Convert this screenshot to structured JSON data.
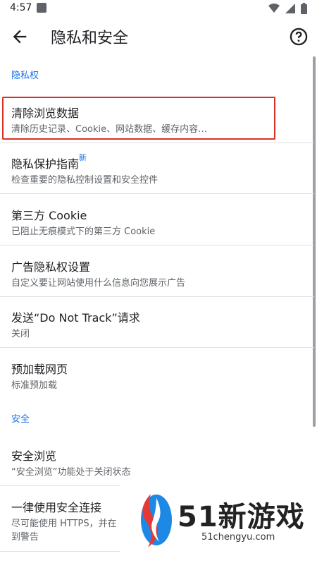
{
  "status_bar": {
    "time": "4:57"
  },
  "app_bar": {
    "title": "隐私和安全"
  },
  "sections": {
    "privacy_header": "隐私权",
    "security_header": "安全"
  },
  "rows": [
    {
      "title": "清除浏览数据",
      "subtitle": "清除历史记录、Cookie、网站数据、缓存内容…"
    },
    {
      "title": "隐私保护指南",
      "badge": "新",
      "subtitle": "检查重要的隐私控制设置和安全控件"
    },
    {
      "title": "第三方 Cookie",
      "subtitle": "已阻止无痕模式下的第三方 Cookie"
    },
    {
      "title": "广告隐私权设置",
      "subtitle": "自定义要让网站使用什么信息向您展示广告"
    },
    {
      "title": "发送“Do Not Track”请求",
      "subtitle": "关闭"
    },
    {
      "title": "预加载网页",
      "subtitle": "标准预加载"
    },
    {
      "title": "安全浏览",
      "subtitle": "“安全浏览”功能处于关闭状态"
    },
    {
      "title": "一律使用安全连接",
      "subtitle": "尽可能使用 HTTPS，并在",
      "subtitle2": "到警告"
    }
  ],
  "watermark": {
    "text": "51新游戏",
    "url": "51chengyu.com"
  }
}
